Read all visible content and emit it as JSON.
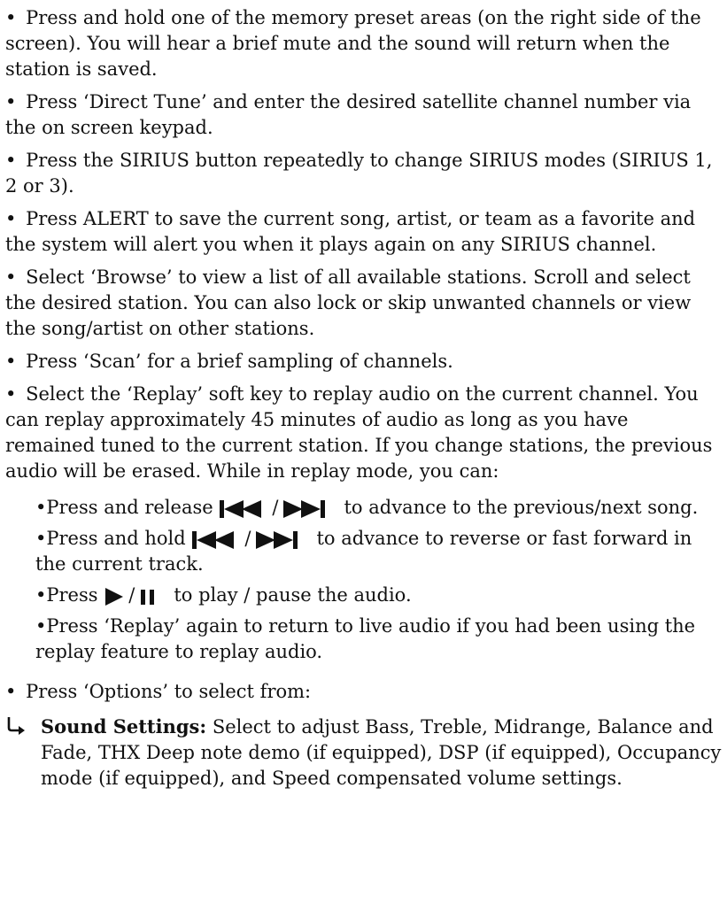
{
  "bullets": [
    "Press and hold one of the memory preset areas (on the right side of the screen). You will hear a brief mute and the sound will return when the station is saved.",
    "Press ‘Direct Tune’ and enter the desired satellite channel number via the on screen keypad.",
    "Press the SIRIUS button repeatedly to change SIRIUS modes (SIRIUS 1, 2 or 3).",
    "Press ALERT to save the current song, artist, or team as a favorite and the system will alert you when it plays again on any SIRIUS channel.",
    "Select ‘Browse’ to view a list of all available stations. Scroll and select the desired station. You can also lock or skip unwanted channels or view the song/artist on other stations.",
    "Press ‘Scan’ for a brief sampling of channels.",
    "Select the ‘Replay’ soft key to replay audio on the current channel. You can replay approximately 45 minutes of audio as long as you have remained tuned to the current station. If you change stations, the previous audio will be erased. While in replay mode, you can:"
  ],
  "replay_items": {
    "item1_pre": "Press and release",
    "item1_post": "to advance to the previous/next song.",
    "item2_pre": "Press and hold",
    "item2_post": "to advance to reverse or fast forward in the current track.",
    "item3_pre": "Press",
    "item3_post": "to play / pause the audio.",
    "item4": "Press ‘Replay’ again to return to live audio if you had been using the replay feature to replay audio."
  },
  "options_bullet": "Press ‘Options’ to select from:",
  "sound_settings": {
    "title": "Sound Settings:",
    "text": "Select to adjust Bass, Treble, Midrange, Balance and Fade, THX Deep note demo (if equipped), DSP (if equipped), Occupancy mode (if equipped), and Speed compensated volume settings."
  },
  "bullet_char": "•",
  "slash": "/",
  "icons": [
    "skip-previous-icon",
    "skip-next-icon",
    "play-icon",
    "pause-icon",
    "hook-arrow-icon"
  ]
}
